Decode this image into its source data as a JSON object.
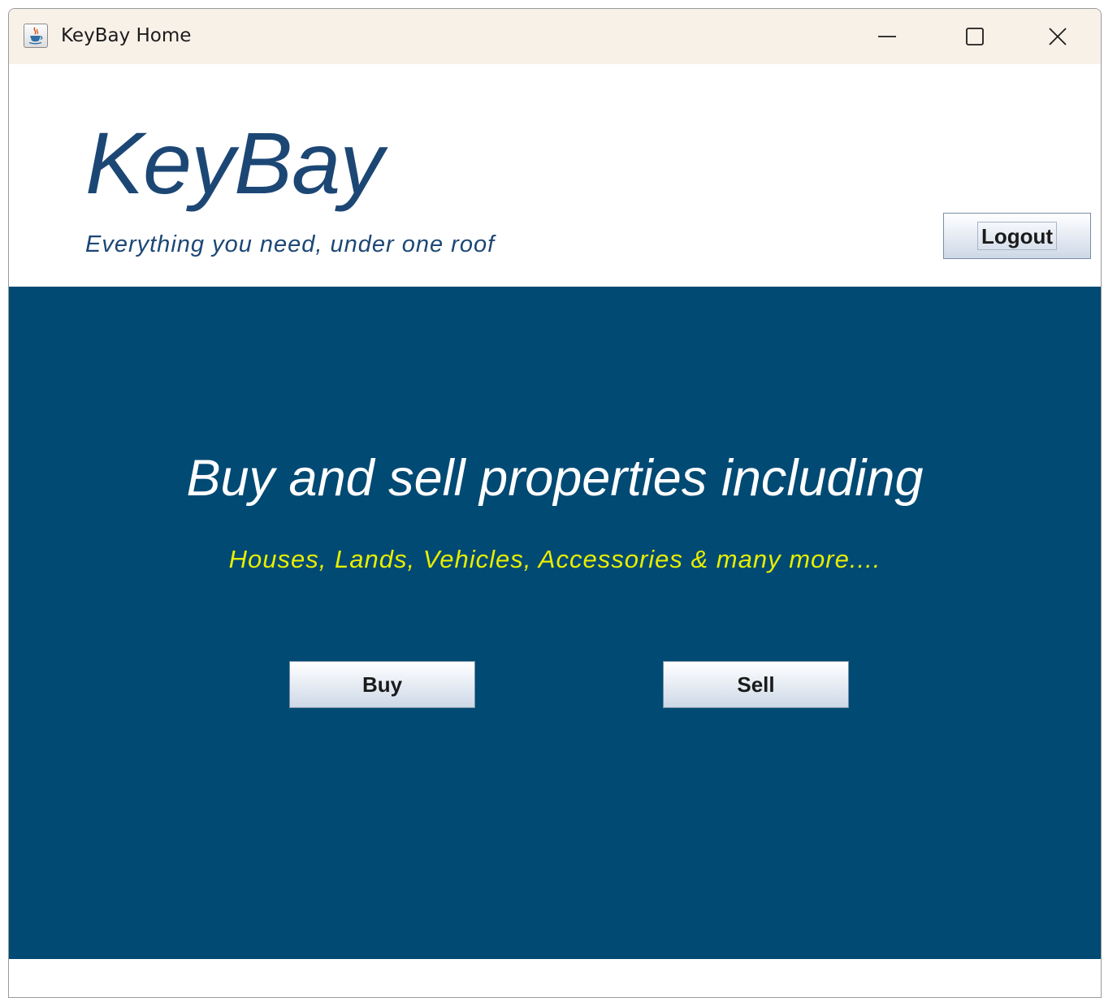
{
  "window": {
    "title": "KeyBay Home"
  },
  "header": {
    "brand": "KeyBay",
    "tagline": "Everything you need, under one roof",
    "logout_label": "Logout"
  },
  "hero": {
    "headline": "Buy and sell properties including",
    "subline": "Houses, Lands, Vehicles, Accessories & many more....",
    "buy_label": "Buy",
    "sell_label": "Sell"
  },
  "colors": {
    "brand_blue": "#1c4775",
    "hero_background": "#004a74",
    "subline_yellow": "#e8ee00",
    "titlebar": "#f8f1e8"
  },
  "icons": {
    "app": "java-coffee-cup-icon",
    "minimize": "minimize-icon",
    "maximize": "maximize-icon",
    "close": "close-icon"
  }
}
